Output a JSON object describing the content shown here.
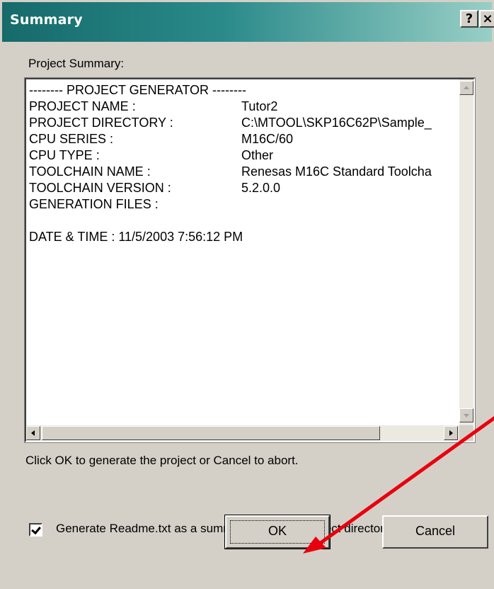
{
  "window": {
    "title": "Summary",
    "help_glyph": "?",
    "close_glyph": "×"
  },
  "summary": {
    "heading": "Project Summary:",
    "lines": [
      {
        "key": "-------- PROJECT GENERATOR --------",
        "value": ""
      },
      {
        "key": "PROJECT NAME :",
        "value": "Tutor2"
      },
      {
        "key": "PROJECT DIRECTORY :",
        "value": "C:\\MTOOL\\SKP16C62P\\Sample_"
      },
      {
        "key": "CPU SERIES :",
        "value": "M16C/60"
      },
      {
        "key": "CPU TYPE :",
        "value": "Other"
      },
      {
        "key": "TOOLCHAIN NAME :",
        "value": "Renesas M16C Standard Toolcha"
      },
      {
        "key": "TOOLCHAIN VERSION :",
        "value": "5.2.0.0"
      },
      {
        "key": "GENERATION FILES :",
        "value": ""
      },
      {
        "key": "",
        "value": ""
      },
      {
        "key": "DATE & TIME : 11/5/2003 7:56:12 PM",
        "value": ""
      }
    ]
  },
  "instruction": "Click OK to generate the project or Cancel to abort.",
  "readme_option": {
    "label": "Generate Readme.txt as a summary file in the project directory",
    "checked": true
  },
  "buttons": {
    "ok": "OK",
    "cancel": "Cancel"
  },
  "colors": {
    "title_gradient_start": "#166a6a",
    "title_gradient_end": "#98cfc6",
    "annotation_arrow": "#e8000f",
    "dialog_face": "#d4d0c8"
  }
}
